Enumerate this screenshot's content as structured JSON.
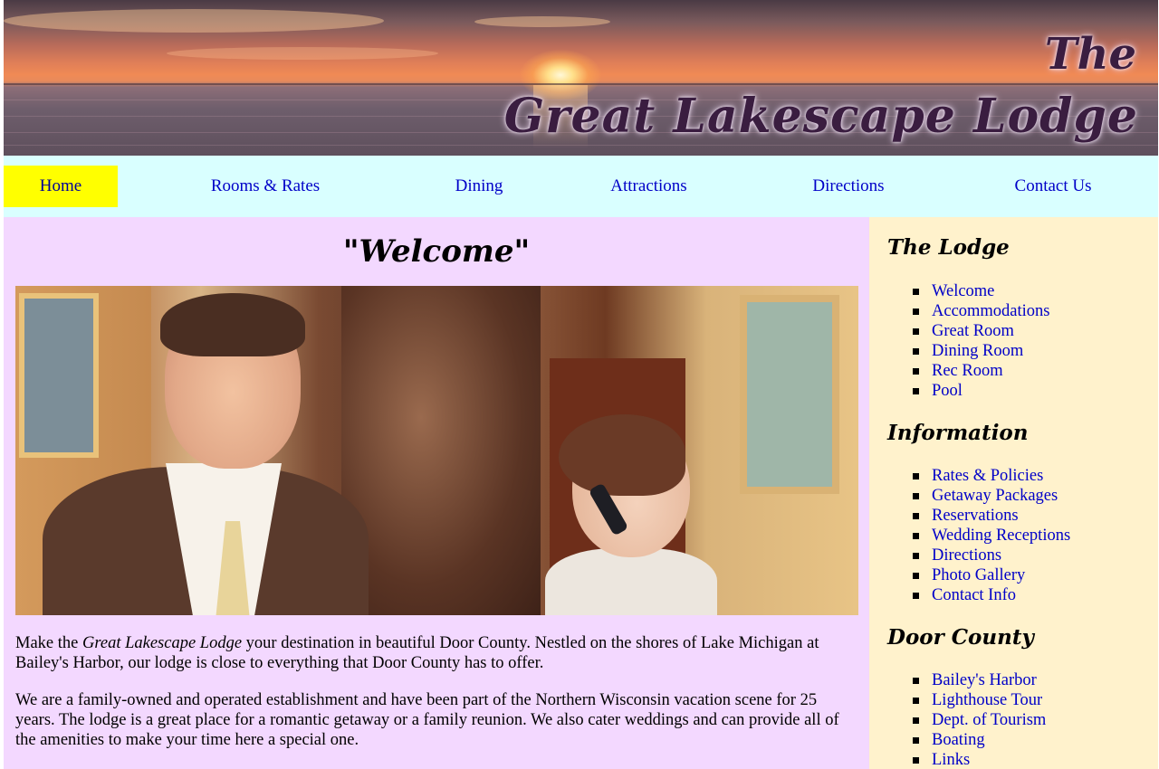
{
  "banner": {
    "the": "The",
    "title": "Great Lakescape Lodge"
  },
  "nav": {
    "items": [
      {
        "label": "Home",
        "active": true
      },
      {
        "label": "Rooms & Rates"
      },
      {
        "label": "Dining"
      },
      {
        "label": "Attractions"
      },
      {
        "label": "Directions"
      },
      {
        "label": "Contact Us"
      }
    ]
  },
  "main": {
    "heading": "\"Welcome\"",
    "intro1": {
      "before": "Make the ",
      "emphasis": "Great Lakescape Lodge",
      "after": " your destination in beautiful Door County. Nestled on the shores of Lake Michigan at Bailey's Harbor, our lodge is close to everything that Door County has to offer."
    },
    "intro2": "We are a family-owned and operated establishment and have been part of the Northern Wisconsin vacation scene for 25 years. The lodge is a great place for a romantic getaway or a family reunion. We also cater weddings and can provide all of the amenities to make your time here a special one."
  },
  "sidebar": {
    "lodge": {
      "heading": "The Lodge",
      "items": [
        "Welcome",
        "Accommodations",
        "Great Room",
        "Dining Room",
        "Rec Room",
        "Pool"
      ]
    },
    "information": {
      "heading": "Information",
      "items": [
        "Rates & Policies",
        "Getaway Packages",
        "Reservations",
        "Wedding Receptions",
        "Directions",
        "Photo Gallery",
        "Contact Info"
      ]
    },
    "door_county": {
      "heading": "Door County",
      "items": [
        "Bailey's Harbor",
        "Lighthouse Tour",
        "Dept. of Tourism",
        "Boating",
        "Links"
      ]
    }
  },
  "colors": {
    "nav_background": "#d9ffff",
    "nav_active": "#ffff00",
    "main_background": "#f3d8ff",
    "sidebar_background": "#fff2cc",
    "link": "#0000c8"
  }
}
